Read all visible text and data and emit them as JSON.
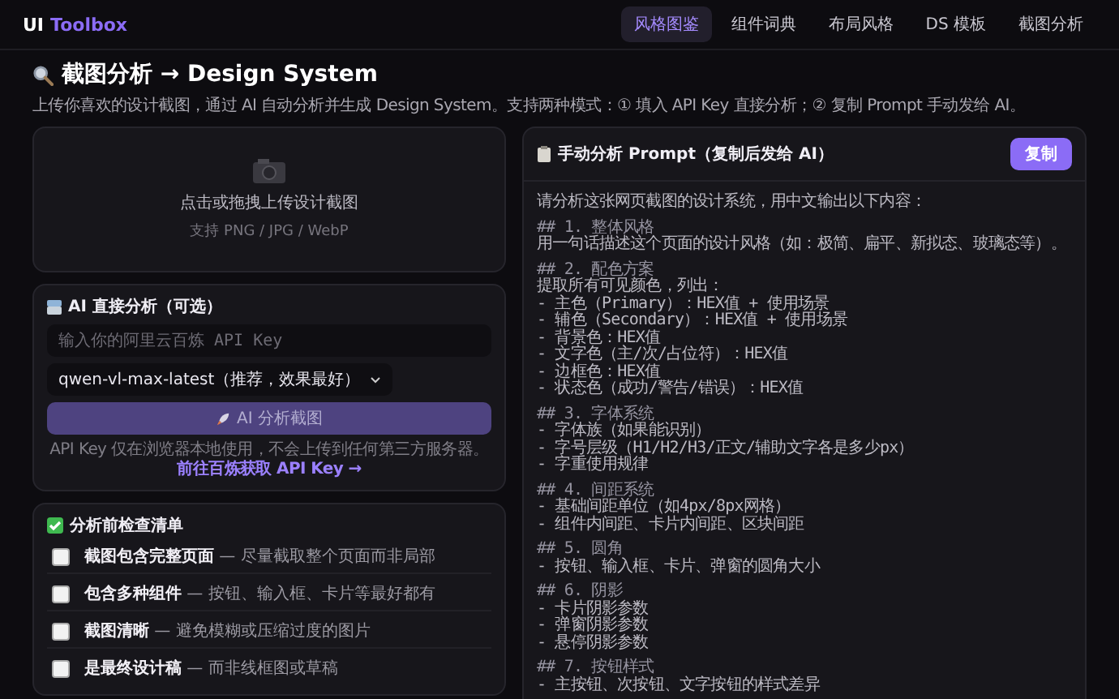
{
  "brand": {
    "prefix": "UI",
    "name": "Toolbox"
  },
  "nav": [
    {
      "label": "风格图鉴",
      "selected": true
    },
    {
      "label": "组件词典",
      "selected": false
    },
    {
      "label": "布局风格",
      "selected": false
    },
    {
      "label": "DS 模板",
      "selected": false
    },
    {
      "label": "截图分析",
      "selected": false
    }
  ],
  "page": {
    "title": "截图分析 → Design System",
    "subtitle": "上传你喜欢的设计截图，通过 AI 自动分析并生成 Design System。支持两种模式：① 填入 API Key 直接分析；② 复制 Prompt 手动发给 AI。"
  },
  "upload": {
    "label": "点击或拖拽上传设计截图",
    "hint": "支持 PNG / JPG / WebP"
  },
  "ai_card": {
    "title": "AI 直接分析（可选）",
    "api_key": {
      "placeholder": "输入你的阿里云百炼 API Key"
    },
    "model": {
      "value": "qwen-vl-max-latest（推荐，效果最好）"
    },
    "analyze_button": {
      "label": "AI 分析截图",
      "disabled": true
    },
    "note": "API Key 仅在浏览器本地使用，不会上传到任何第三方服务器。",
    "note_link": "前往百炼获取 API Key →"
  },
  "checklist": {
    "title": "分析前检查清单",
    "items": [
      {
        "text": "**截图包含完整页面** — 尽量截取整个页面而非局部",
        "checked": false
      },
      {
        "text": "**包含多种组件** — 按钮、输入框、卡片等最好都有",
        "checked": false
      },
      {
        "text": "**截图清晰** — 避免模糊或压缩过度的图片",
        "checked": false
      },
      {
        "text": "**是最终设计稿** — 而非线框图或草稿",
        "checked": false
      }
    ]
  },
  "prompt": {
    "title": "手动分析 Prompt（复制后发给 AI）",
    "copy_button": "复制",
    "intro": "请分析这张网页截图的设计系统，用中文输出以下内容：",
    "sections": [
      {
        "heading": "## 1. 整体风格",
        "lines": [
          "用一句话描述这个页面的设计风格（如：极简、扁平、新拟态、玻璃态等）。"
        ]
      },
      {
        "heading": "## 2. 配色方案",
        "lines": [
          "提取所有可见颜色，列出：",
          "- 主色（Primary）：HEX值 + 使用场景",
          "- 辅色（Secondary）：HEX值 + 使用场景",
          "- 背景色：HEX值",
          "- 文字色（主/次/占位符）：HEX值",
          "- 边框色：HEX值",
          "- 状态色（成功/警告/错误）：HEX值"
        ]
      },
      {
        "heading": "## 3. 字体系统",
        "lines": [
          "- 字体族（如果能识别）",
          "- 字号层级（H1/H2/H3/正文/辅助文字各是多少px）",
          "- 字重使用规律"
        ]
      },
      {
        "heading": "## 4. 间距系统",
        "lines": [
          "- 基础间距单位（如4px/8px网格）",
          "- 组件内间距、卡片内间距、区块间距"
        ]
      },
      {
        "heading": "## 5. 圆角",
        "lines": [
          "- 按钮、输入框、卡片、弹窗的圆角大小"
        ]
      },
      {
        "heading": "## 6. 阴影",
        "lines": [
          "- 卡片阴影参数",
          "- 弹窗阴影参数",
          "- 悬停阴影参数"
        ]
      },
      {
        "heading": "## 7. 按钮样式",
        "lines": [
          "- 主按钮、次按钮、文字按钮的样式差异"
        ]
      }
    ]
  }
}
